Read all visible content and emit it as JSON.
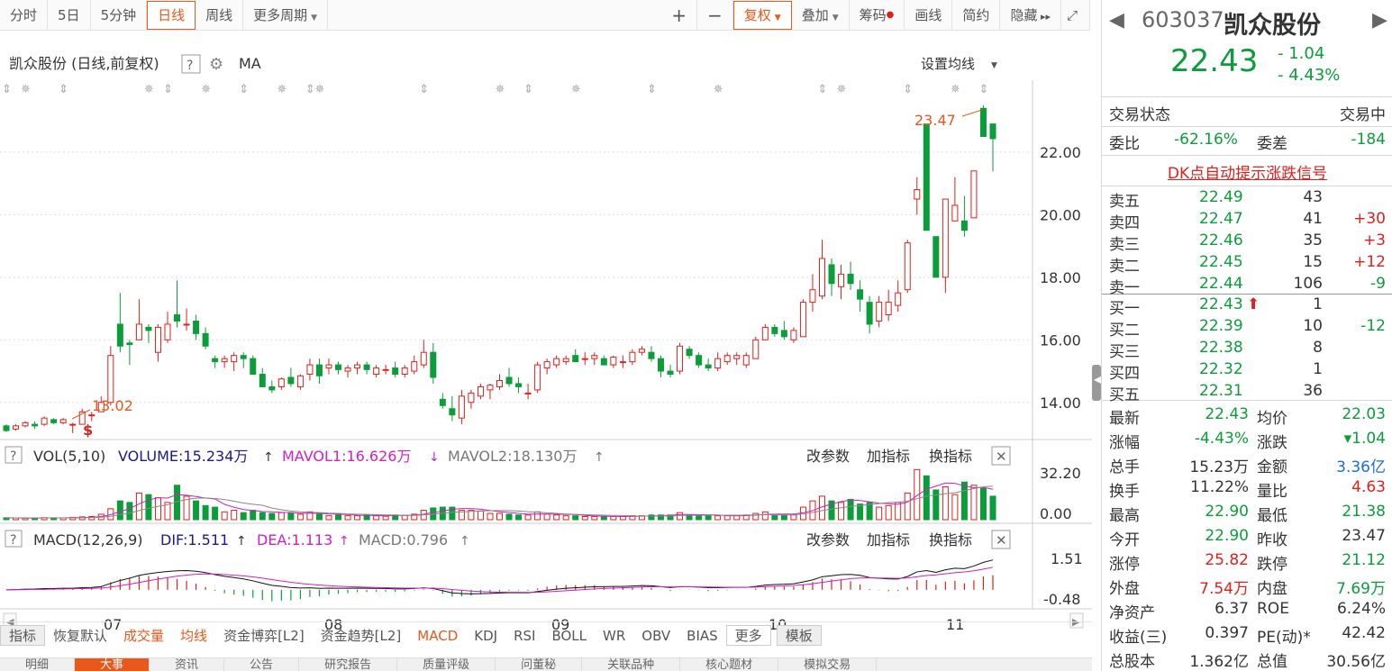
{
  "toolbar": {
    "items": [
      "分时",
      "5日",
      "5分钟",
      "日线",
      "周线",
      "更多周期"
    ],
    "right": [
      "+",
      "−",
      "复权",
      "叠加",
      "筹码",
      "画线",
      "简约",
      "隐藏"
    ]
  },
  "chart": {
    "title": "凯众股份 (日线,前复权)",
    "help": "?",
    "ma": "MA",
    "set_ma": "设置均线",
    "price_ticks": [
      "22.00",
      "20.00",
      "18.00",
      "16.00",
      "14.00"
    ],
    "high_label": "23.47",
    "low_label": "13.02",
    "dollar": "$"
  },
  "vol": {
    "name": "VOL(5,10)",
    "volume": "VOLUME:15.234万",
    "mavol1": "MAVOL1:16.626万",
    "mavol2": "MAVOL2:18.130万",
    "ticks": [
      "32.20",
      "0.00"
    ],
    "actions": [
      "改参数",
      "加指标",
      "换指标"
    ]
  },
  "macd": {
    "name": "MACD(12,26,9)",
    "dif": "DIF:1.511",
    "dea": "DEA:1.113",
    "macd": "MACD:0.796",
    "ticks": [
      "1.51",
      "-0.48"
    ],
    "actions": [
      "改参数",
      "加指标",
      "换指标"
    ]
  },
  "xaxis": [
    "07",
    "08",
    "09",
    "10",
    "11"
  ],
  "bottom": [
    "指标",
    "恢复默认",
    "成交量",
    "均线",
    "资金博弈[L2]",
    "资金趋势[L2]",
    "MACD",
    "KDJ",
    "RSI",
    "BOLL",
    "WR",
    "OBV",
    "BIAS",
    "更多",
    "模板"
  ],
  "quote": {
    "code": "603037",
    "name": "凯众股份",
    "price": "22.43",
    "change": "- 1.04",
    "pct": "- 4.43%",
    "status_label": "交易状态",
    "status": "交易中",
    "wb_label": "委比",
    "wb": "-62.16%",
    "wc_label": "委差",
    "wc": "-184",
    "dk": "DK点自动提示涨跌信号"
  },
  "asks": [
    {
      "l": "卖五",
      "p": "22.49",
      "v": "43",
      "d": ""
    },
    {
      "l": "卖四",
      "p": "22.47",
      "v": "41",
      "d": "+30"
    },
    {
      "l": "卖三",
      "p": "22.46",
      "v": "35",
      "d": "+3"
    },
    {
      "l": "卖二",
      "p": "22.45",
      "v": "15",
      "d": "+12"
    },
    {
      "l": "卖一",
      "p": "22.44",
      "v": "106",
      "d": "-9"
    }
  ],
  "bids": [
    {
      "l": "买一",
      "p": "22.43",
      "v": "1",
      "d": ""
    },
    {
      "l": "买二",
      "p": "22.39",
      "v": "10",
      "d": "-12"
    },
    {
      "l": "买三",
      "p": "22.38",
      "v": "8",
      "d": ""
    },
    {
      "l": "买四",
      "p": "22.32",
      "v": "1",
      "d": ""
    },
    {
      "l": "买五",
      "p": "22.31",
      "v": "36",
      "d": ""
    }
  ],
  "stats": [
    {
      "l1": "最新",
      "v1": "22.43",
      "l2": "均价",
      "v2": "22.03"
    },
    {
      "l1": "涨幅",
      "v1": "-4.43%",
      "l2": "涨跌",
      "v2": "▾1.04"
    },
    {
      "l1": "总手",
      "v1": "15.23万",
      "l2": "金额",
      "v2": "3.36亿"
    },
    {
      "l1": "换手",
      "v1": "11.22%",
      "l2": "量比",
      "v2": "4.63"
    },
    {
      "l1": "最高",
      "v1": "22.90",
      "l2": "最低",
      "v2": "21.38"
    },
    {
      "l1": "今开",
      "v1": "22.90",
      "l2": "昨收",
      "v2": "23.47"
    },
    {
      "l1": "涨停",
      "v1": "25.82",
      "l2": "跌停",
      "v2": "21.12"
    },
    {
      "l1": "外盘",
      "v1": "7.54万",
      "l2": "内盘",
      "v2": "7.69万"
    },
    {
      "l1": "净资产",
      "v1": "6.37",
      "l2": "ROE",
      "v2": "6.24%"
    },
    {
      "l1": "收益(三)",
      "v1": "0.397",
      "l2": "PE(动)*",
      "v2": "42.42"
    },
    {
      "l1": "总股本",
      "v1": "1.362亿",
      "l2": "总值",
      "v2": "30.56亿"
    }
  ],
  "tabs": [
    "明细",
    "大事",
    "资讯",
    "公告",
    "研究报告",
    "质量评级",
    "问董秘",
    "关联品种",
    "核心题材",
    "模拟交易"
  ],
  "candles": [
    [
      13.25,
      13.3,
      13.05,
      13.1
    ],
    [
      13.15,
      13.3,
      13.1,
      13.25
    ],
    [
      13.25,
      13.4,
      13.2,
      13.35
    ],
    [
      13.3,
      13.4,
      13.15,
      13.25
    ],
    [
      13.3,
      13.55,
      13.25,
      13.5
    ],
    [
      13.45,
      13.5,
      13.3,
      13.35
    ],
    [
      13.35,
      13.5,
      13.3,
      13.45
    ],
    [
      13.3,
      13.35,
      13.02,
      13.3
    ],
    [
      13.3,
      13.8,
      13.3,
      13.7
    ],
    [
      13.6,
      13.7,
      13.4,
      13.6
    ],
    [
      13.7,
      14.2,
      13.9,
      14
    ],
    [
      14,
      15.8,
      13.9,
      15.5
    ],
    [
      16.5,
      17.5,
      15.6,
      15.8
    ],
    [
      15.9,
      16,
      15.2,
      15.85
    ],
    [
      16,
      17.3,
      16,
      16.5
    ],
    [
      16.4,
      16.5,
      15.9,
      16.3
    ],
    [
      15.6,
      16.5,
      15.3,
      16.4
    ],
    [
      16,
      16.9,
      15.9,
      16.5
    ],
    [
      16.8,
      17.9,
      16.4,
      16.6
    ],
    [
      16.5,
      17,
      16.3,
      16.5
    ],
    [
      16.6,
      16.8,
      16,
      16.2
    ],
    [
      16.2,
      16.4,
      15.7,
      15.8
    ],
    [
      15.4,
      15.5,
      15.1,
      15.3
    ],
    [
      15.3,
      15.5,
      15.1,
      15.4
    ],
    [
      15.3,
      15.6,
      15,
      15.5
    ],
    [
      15.5,
      15.6,
      15.1,
      15.4
    ],
    [
      15.4,
      15.5,
      14.9,
      14.9
    ],
    [
      14.9,
      15.1,
      14.5,
      14.5
    ],
    [
      14.5,
      14.7,
      14.3,
      14.4
    ],
    [
      14.5,
      14.8,
      14.4,
      14.75
    ],
    [
      14.8,
      15.1,
      14.5,
      14.6
    ],
    [
      14.5,
      14.9,
      14.4,
      14.85
    ],
    [
      14.9,
      15.4,
      14.7,
      15.2
    ],
    [
      15.2,
      15.4,
      14.6,
      14.85
    ],
    [
      15.1,
      15.4,
      14.9,
      15.2
    ],
    [
      15.2,
      15.3,
      14.9,
      15.05
    ],
    [
      15,
      15.2,
      14.8,
      15.1
    ],
    [
      15.1,
      15.3,
      14.9,
      15.2
    ],
    [
      15.2,
      15.3,
      14.9,
      15.05
    ],
    [
      14.9,
      15.2,
      14.8,
      15.1
    ],
    [
      15.05,
      15.2,
      14.9,
      15.05
    ],
    [
      15.1,
      15.3,
      14.8,
      14.9
    ],
    [
      14.9,
      15.2,
      14.8,
      15.1
    ],
    [
      15,
      15.5,
      14.9,
      15.3
    ],
    [
      15.2,
      16,
      15.1,
      15.6
    ],
    [
      15.6,
      15.9,
      14.6,
      14.8
    ],
    [
      14.1,
      14.3,
      13.8,
      13.9
    ],
    [
      13.8,
      14.2,
      13.4,
      13.6
    ],
    [
      13.5,
      14.4,
      13.3,
      14.2
    ],
    [
      14,
      14.4,
      13.8,
      14.3
    ],
    [
      14.2,
      14.6,
      14.1,
      14.5
    ],
    [
      14.4,
      14.6,
      14.1,
      14.55
    ],
    [
      14.5,
      14.9,
      14.4,
      14.7
    ],
    [
      14.8,
      15.1,
      14.5,
      14.6
    ],
    [
      14.6,
      14.8,
      14.3,
      14.5
    ],
    [
      14.3,
      14.6,
      14.1,
      14.3
    ],
    [
      14.4,
      15.3,
      14.3,
      15.2
    ],
    [
      15.1,
      15.4,
      14.9,
      15.3
    ],
    [
      15.2,
      15.5,
      15.1,
      15.4
    ],
    [
      15.3,
      15.5,
      15.2,
      15.4
    ],
    [
      15.5,
      15.7,
      15.3,
      15.3
    ],
    [
      15.4,
      15.6,
      15.2,
      15.4
    ],
    [
      15.4,
      15.6,
      15.2,
      15.5
    ],
    [
      15.4,
      15.5,
      15.2,
      15.2
    ],
    [
      15.2,
      15.5,
      15.1,
      15.45
    ],
    [
      15.3,
      15.5,
      15.1,
      15.3
    ],
    [
      15.3,
      15.7,
      15.2,
      15.6
    ],
    [
      15.6,
      15.8,
      15.5,
      15.7
    ],
    [
      15.6,
      15.8,
      15.3,
      15.4
    ],
    [
      15.4,
      15.5,
      14.8,
      15
    ],
    [
      15,
      15.2,
      14.8,
      14.9
    ],
    [
      15,
      15.9,
      14.9,
      15.8
    ],
    [
      15.7,
      15.8,
      15.4,
      15.5
    ],
    [
      15.5,
      15.6,
      15.1,
      15.2
    ],
    [
      15.2,
      15.4,
      15,
      15.1
    ],
    [
      15.1,
      15.6,
      15,
      15.4
    ],
    [
      15.3,
      15.6,
      15.2,
      15.5
    ],
    [
      15.4,
      15.6,
      15.2,
      15.5
    ],
    [
      15.2,
      15.6,
      15.1,
      15.5
    ],
    [
      15.4,
      16.1,
      15.4,
      16
    ],
    [
      16,
      16.5,
      16,
      16.4
    ],
    [
      16.4,
      16.5,
      16.1,
      16.2
    ],
    [
      16.3,
      16.6,
      16,
      16.1
    ],
    [
      16,
      16.4,
      15.9,
      16.3
    ],
    [
      16.1,
      17.3,
      16.1,
      17.2
    ],
    [
      17.2,
      18.1,
      16.9,
      17.6
    ],
    [
      17.4,
      19.2,
      17.3,
      18.6
    ],
    [
      18.4,
      18.6,
      17.4,
      17.8
    ],
    [
      17.7,
      18.4,
      17.3,
      18.1
    ],
    [
      18.1,
      18.5,
      17.6,
      17.8
    ],
    [
      17.6,
      17.9,
      16.9,
      17.3
    ],
    [
      17.2,
      17.4,
      16.2,
      16.5
    ],
    [
      16.6,
      17.4,
      16.4,
      17.2
    ],
    [
      16.8,
      17.6,
      16.6,
      17.2
    ],
    [
      17.1,
      17.9,
      16.9,
      17.5
    ],
    [
      17.6,
      19.2,
      17.5,
      19.1
    ],
    [
      20.5,
      21.2,
      20,
      20.8
    ],
    [
      22.9,
      22.9,
      19.5,
      19.5
    ],
    [
      19.3,
      19.3,
      18,
      18
    ],
    [
      18,
      20.5,
      17.5,
      20.5
    ],
    [
      19.8,
      21.2,
      19.8,
      20.3
    ],
    [
      19.8,
      20.6,
      19.3,
      19.5
    ],
    [
      19.9,
      21.4,
      19.9,
      21.4
    ],
    [
      23.4,
      23.5,
      22.5,
      22.5
    ],
    [
      22.9,
      22.9,
      21.38,
      22.43
    ]
  ],
  "vols": [
    1.2,
    1.1,
    1,
    1.1,
    1.3,
    1.2,
    1.2,
    1.5,
    1.8,
    2,
    3.5,
    7,
    12,
    11,
    17,
    16,
    14,
    11,
    22,
    15,
    12,
    9,
    8,
    5,
    6,
    4.5,
    6,
    4.5,
    4,
    4.5,
    4,
    3.5,
    5,
    3.5,
    2.5,
    3,
    2.5,
    2.5,
    3,
    2.5,
    2.2,
    3,
    2.8,
    3.5,
    6,
    7.5,
    8,
    8,
    6,
    6,
    5.5,
    4,
    4,
    3.5,
    3,
    3,
    5,
    3.5,
    3,
    2.5,
    2.5,
    2,
    2,
    2,
    2,
    2,
    2.5,
    2.5,
    3,
    3,
    3,
    4.5,
    3,
    2.5,
    2.5,
    2.5,
    2.5,
    2.5,
    3,
    4,
    5,
    3,
    3,
    3,
    8,
    12,
    15,
    12,
    11,
    13,
    10,
    11,
    8,
    9,
    11,
    17,
    32,
    28,
    19,
    21,
    16,
    24,
    22,
    20,
    15
  ]
}
